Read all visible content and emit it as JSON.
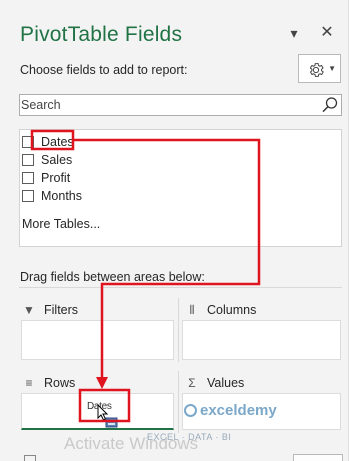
{
  "panel": {
    "title": "PivotTable Fields",
    "choose_label": "Choose fields to add to report:",
    "dropdown_icon": "chevron-down-icon",
    "close_icon": "close-icon",
    "settings_icon": "gear-icon"
  },
  "search": {
    "placeholder": "Search",
    "icon": "search-icon"
  },
  "fields": [
    {
      "label": "Dates",
      "checked": false
    },
    {
      "label": "Sales",
      "checked": false
    },
    {
      "label": "Profit",
      "checked": false
    },
    {
      "label": "Months",
      "checked": false
    }
  ],
  "more_tables": "More Tables...",
  "areas": {
    "drag_label": "Drag fields between areas below:",
    "filters": {
      "label": "Filters",
      "icon": "filter-icon"
    },
    "columns": {
      "label": "Columns",
      "icon": "columns-icon"
    },
    "rows": {
      "label": "Rows",
      "icon": "rows-icon"
    },
    "values": {
      "label": "Values",
      "icon": "sigma-icon"
    }
  },
  "drag_item": "Dates",
  "watermark": {
    "activate": "Activate Windows",
    "brand": "exceldemy",
    "brand_sub": "EXCEL · DATA · BI"
  },
  "colors": {
    "title": "#217346",
    "annotation": "#e0141e",
    "rows_underline": "#217346"
  }
}
